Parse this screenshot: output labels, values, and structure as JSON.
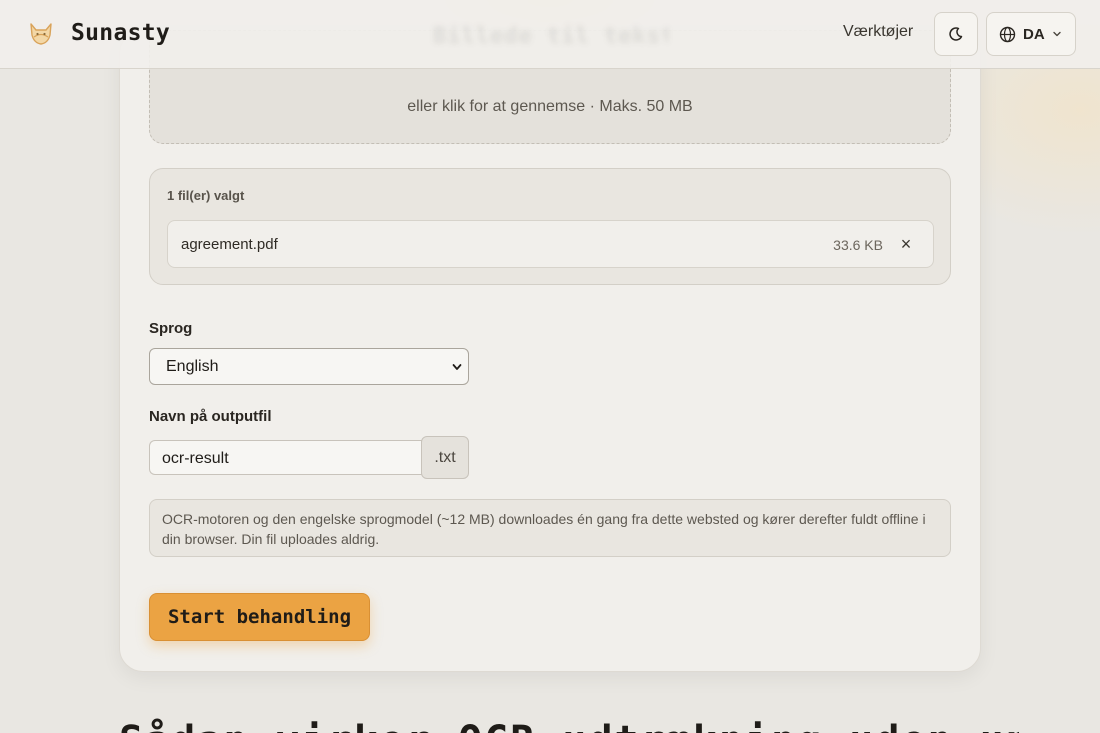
{
  "header": {
    "brand_name": "Sunasty",
    "ghost_title": "Billede til tekst (OCR)",
    "nav_tools_label": "Værktøjer",
    "language_code": "DA",
    "icons": {
      "logo": "fox-logo-icon",
      "theme": "moon-icon",
      "language": "globe-icon",
      "dropdown": "chevron-down-icon"
    }
  },
  "dropzone": {
    "hint": "eller klik for at gennemse · Maks. 50 MB"
  },
  "files": {
    "count_label": "1 fil(er) valgt",
    "items": [
      {
        "name": "agreement.pdf",
        "size": "33.6 KB",
        "remove_label": "×"
      }
    ]
  },
  "language_field": {
    "label": "Sprog",
    "selected": "English"
  },
  "output_field": {
    "label": "Navn på outputfil",
    "value": "ocr-result",
    "extension": ".txt"
  },
  "info_text": "OCR-motoren og den engelske sprogmodel (~12 MB) downloades én gang fra dette websted og kører derefter fuldt offline i din browser. Din fil uploades aldrig.",
  "start_button_label": "Start behandling",
  "next_section_heading": "Sådan virker OCR-udtrækning uden upload",
  "colors": {
    "accent": "#eba343",
    "background": "#e9e7e2",
    "card": "#f1efeb",
    "text": "#2a2621"
  }
}
